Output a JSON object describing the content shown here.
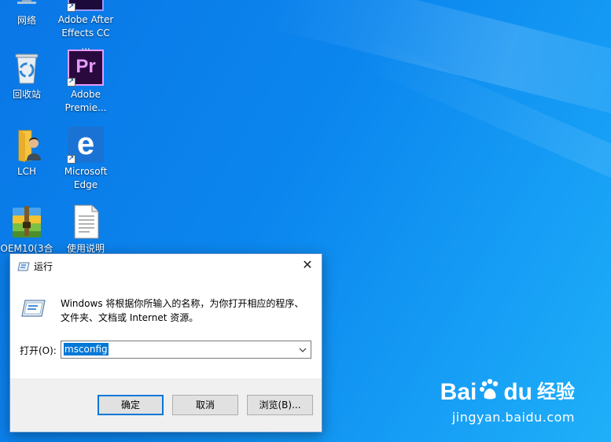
{
  "desktop": {
    "icons": [
      {
        "label": "网络",
        "icon": "network-icon"
      },
      {
        "label": "Adobe After\nEffects CC ...",
        "icon": "after-effects-icon"
      },
      {
        "label": "回收站",
        "icon": "recycle-bin-icon"
      },
      {
        "label": "Adobe\nPremie...",
        "icon": "premiere-icon",
        "glyph": "Pr"
      },
      {
        "label": "LCH",
        "icon": "user-folder-icon"
      },
      {
        "label": "Microsoft\nEdge",
        "icon": "edge-icon",
        "glyph": "e"
      },
      {
        "label": "OEM10(3合",
        "icon": "archive-icon"
      },
      {
        "label": "使用说明",
        "icon": "text-document-icon"
      }
    ]
  },
  "run_dialog": {
    "title": "运行",
    "close_glyph": "✕",
    "description": "Windows 将根据你所输入的名称，为你打开相应的程序、\n文件夹、文档或 Internet 资源。",
    "open_label": "打开(O):",
    "input_value": "msconfig",
    "buttons": {
      "ok": "确定",
      "cancel": "取消",
      "browse": "浏览(B)..."
    }
  },
  "watermark": {
    "logo_left": "Bai",
    "logo_right": "du",
    "logo_suffix": "经验",
    "url": "jingyan.baidu.com"
  },
  "colors": {
    "desktop_blue": "#0b86ee",
    "selection": "#0078d7",
    "premiere_bg": "#2a0a3e",
    "premiere_fg": "#e59cff",
    "edge_blue": "#1a73d4"
  }
}
